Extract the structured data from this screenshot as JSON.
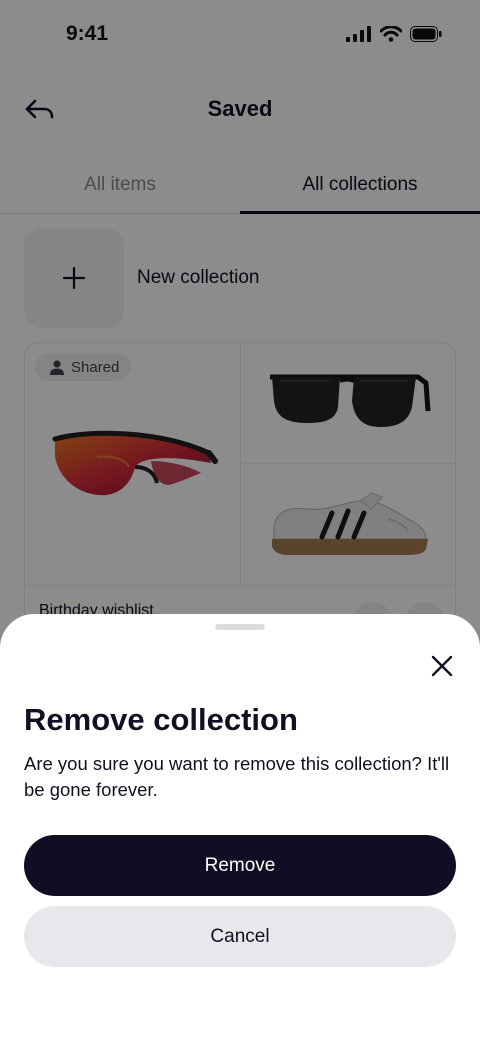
{
  "status_bar": {
    "time": "9:41",
    "icons": [
      "signal-icon",
      "wifi-icon",
      "battery-icon"
    ]
  },
  "header": {
    "title": "Saved",
    "back_icon": "back-arrow-icon"
  },
  "tabs": [
    {
      "label": "All items",
      "active": false
    },
    {
      "label": "All collections",
      "active": true
    }
  ],
  "new_collection": {
    "label": "New collection",
    "icon": "plus-icon"
  },
  "collection_card": {
    "badge": "Shared",
    "badge_icon": "person-icon",
    "name": "Birthday wishlist",
    "images": [
      "sport-sunglasses-image",
      "sunglasses-image",
      "sneaker-image"
    ]
  },
  "sheet": {
    "title": "Remove collection",
    "message": "Are you sure you want to remove this collection? It'll be gone forever.",
    "remove_label": "Remove",
    "cancel_label": "Cancel",
    "close_icon": "close-icon"
  },
  "colors": {
    "primary": "#110d24",
    "secondary_button": "#e8e8ec",
    "scrim": "rgba(0,0,0,0.45)"
  }
}
